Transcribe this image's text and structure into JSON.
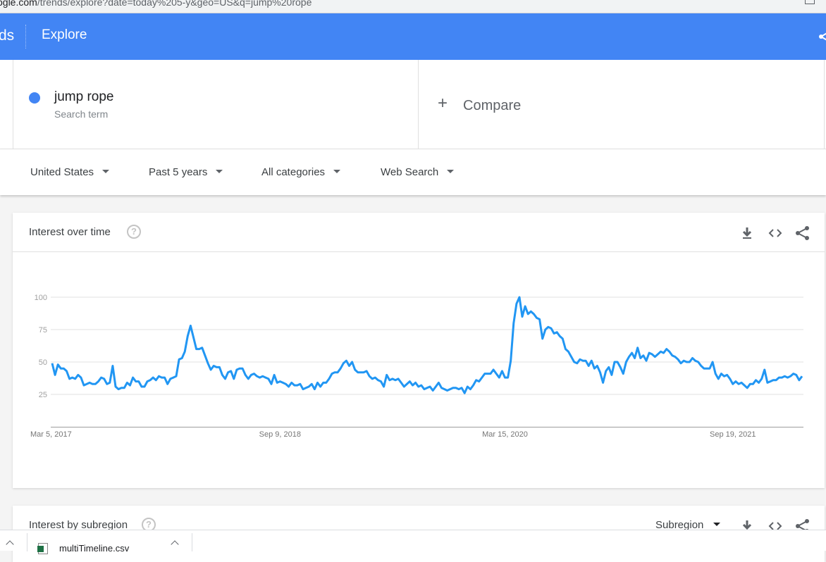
{
  "browser": {
    "url_domain": "ogle.com",
    "url_path": "/trends/explore?date=today%205-y&geo=US&q=jump%20rope"
  },
  "header": {
    "brand_fragment": "ds",
    "title": "Explore"
  },
  "search_term": {
    "name": "jump rope",
    "subtitle": "Search term",
    "color": "#4285f4"
  },
  "compare": {
    "icon": "+",
    "label": "Compare"
  },
  "filters": {
    "region": "United States",
    "time_range": "Past 5 years",
    "category": "All categories",
    "search_type": "Web Search"
  },
  "interest_over_time": {
    "title": "Interest over time",
    "help_icon": "?"
  },
  "interest_by_subregion": {
    "title": "Interest by subregion",
    "help_icon": "?",
    "resolution": "Subregion"
  },
  "downloads_bar": {
    "file_name": "multiTimeline.csv"
  },
  "chart_data": {
    "type": "line",
    "title": "Interest over time",
    "xlabel": "",
    "ylabel": "",
    "ylim": [
      0,
      100
    ],
    "yticks": [
      25,
      50,
      75,
      100
    ],
    "xtick_labels": [
      {
        "label": "Mar 5, 2017",
        "index": 0
      },
      {
        "label": "Sep 9, 2018",
        "index": 79
      },
      {
        "label": "Mar 15, 2020",
        "index": 157
      },
      {
        "label": "Sep 19, 2021",
        "index": 236
      }
    ],
    "grid": true,
    "color": "#2196f3",
    "series": [
      {
        "name": "jump rope",
        "values": [
          49,
          40,
          48,
          45,
          45,
          43,
          37,
          38,
          37,
          40,
          38,
          32,
          33,
          34,
          33,
          33,
          35,
          38,
          37,
          33,
          34,
          47,
          31,
          29,
          30,
          30,
          34,
          32,
          38,
          35,
          35,
          31,
          31,
          35,
          36,
          38,
          36,
          39,
          38,
          38,
          33,
          37,
          38,
          39,
          52,
          53,
          58,
          70,
          78,
          69,
          60,
          60,
          61,
          55,
          49,
          44,
          47,
          46,
          46,
          40,
          37,
          42,
          43,
          37,
          44,
          45,
          45,
          40,
          37,
          40,
          41,
          39,
          38,
          39,
          38,
          37,
          33,
          40,
          34,
          35,
          34,
          33,
          31,
          34,
          32,
          32,
          33,
          29,
          30,
          31,
          33,
          29,
          34,
          31,
          34,
          34,
          37,
          41,
          42,
          42,
          45,
          49,
          51,
          47,
          50,
          44,
          42,
          42,
          42,
          43,
          39,
          37,
          38,
          36,
          35,
          31,
          40,
          36,
          37,
          36,
          37,
          34,
          31,
          33,
          35,
          32,
          34,
          31,
          32,
          29,
          30,
          31,
          28,
          31,
          34,
          30,
          29,
          28,
          29,
          30,
          30,
          29,
          30,
          26,
          31,
          29,
          32,
          36,
          35,
          38,
          41,
          41,
          41,
          44,
          41,
          38,
          43,
          38,
          38,
          51,
          80,
          95,
          100,
          85,
          93,
          87,
          89,
          87,
          84,
          83,
          68,
          75,
          77,
          76,
          72,
          73,
          70,
          68,
          60,
          58,
          54,
          50,
          49,
          52,
          51,
          51,
          47,
          51,
          45,
          47,
          42,
          34,
          43,
          46,
          40,
          50,
          50,
          46,
          41,
          50,
          54,
          57,
          53,
          61,
          53,
          55,
          51,
          57,
          56,
          54,
          56,
          58,
          57,
          60,
          58,
          55,
          54,
          52,
          49,
          51,
          50,
          50,
          53,
          51,
          50,
          47,
          45,
          45,
          45,
          50,
          41,
          37,
          41,
          39,
          40,
          37,
          33,
          35,
          33,
          34,
          32,
          30,
          33,
          33,
          36,
          34,
          37,
          44,
          34,
          35,
          36,
          36,
          38,
          38,
          39,
          38,
          39,
          41,
          40,
          36,
          39
        ]
      }
    ]
  }
}
